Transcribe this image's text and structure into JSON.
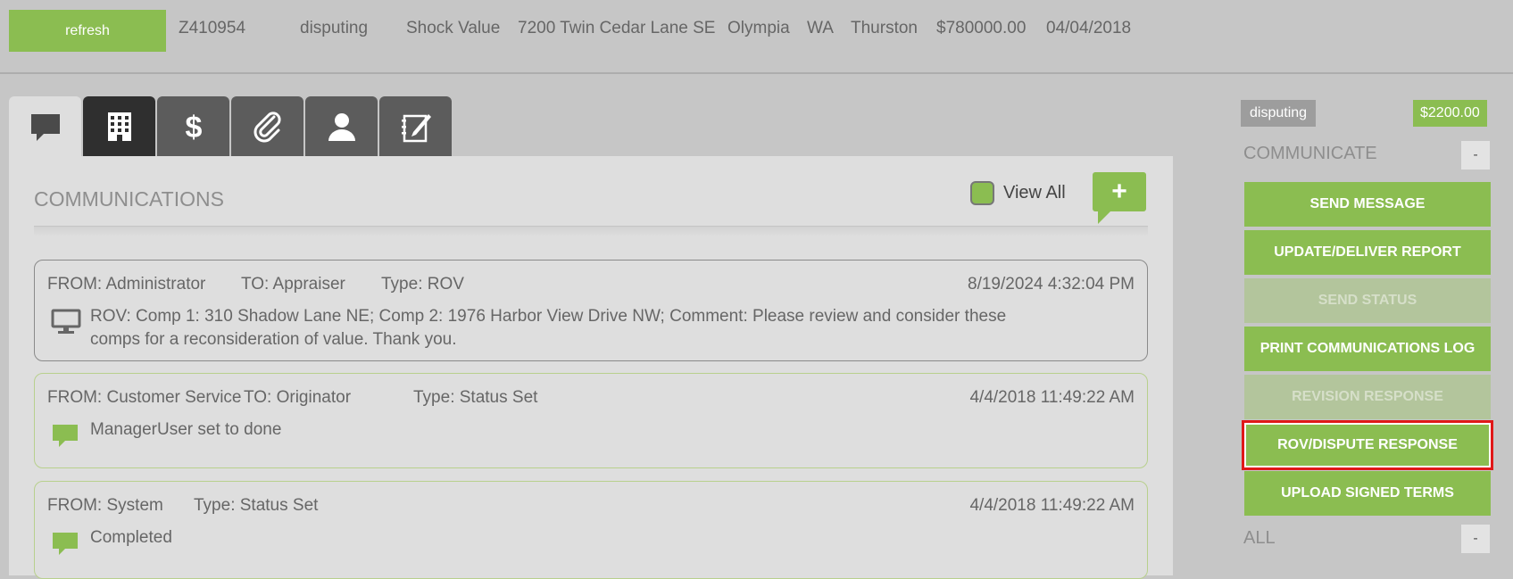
{
  "header": {
    "refresh_label": "refresh",
    "order_id": "Z410954",
    "status": "disputing",
    "borrower": "Shock Value",
    "address": "7200 Twin Cedar Lane SE",
    "city": "Olympia",
    "state": "WA",
    "county": "Thurston",
    "amount": "$780000.00",
    "date": "04/04/2018"
  },
  "tabs": [
    {
      "name": "communications-tab",
      "icon": "speech-bubble-icon"
    },
    {
      "name": "property-tab",
      "icon": "building-icon"
    },
    {
      "name": "fees-tab",
      "icon": "dollar-icon"
    },
    {
      "name": "attachments-tab",
      "icon": "paperclip-icon"
    },
    {
      "name": "contacts-tab",
      "icon": "person-icon"
    },
    {
      "name": "notes-tab",
      "icon": "notebook-pen-icon"
    }
  ],
  "communications": {
    "title": "COMMUNICATIONS",
    "view_all_label": "View All",
    "add_label": "+",
    "messages": [
      {
        "from": "FROM: Administrator",
        "to": "TO: Appraiser",
        "type": "Type: ROV",
        "date": "8/19/2024 4:32:04 PM",
        "body": "ROV: Comp 1: 310 Shadow Lane NE; Comp 2: 1976 Harbor View Drive NW; Comment: Please review and consider these comps for a reconsideration of value. Thank you.",
        "icon": "monitor-icon"
      },
      {
        "from": "FROM: Customer Service",
        "to": "TO: Originator",
        "type": "Type: Status Set",
        "date": "4/4/2018 11:49:22 AM",
        "body": "ManagerUser set to done",
        "icon": "speech-bubble-icon"
      },
      {
        "from": "FROM: System",
        "type": "Type: Status Set",
        "date": "4/4/2018 11:49:22 AM",
        "body": "Completed",
        "icon": "speech-bubble-icon"
      }
    ]
  },
  "sidebar": {
    "status_badge": "disputing",
    "fee_badge": "$2200.00",
    "communicate_label": "COMMUNICATE",
    "communicate_toggle": "-",
    "buttons": {
      "send_message": "SEND MESSAGE",
      "update_deliver": "UPDATE/DELIVER REPORT",
      "send_status": "SEND STATUS",
      "print_log": "PRINT COMMUNICATIONS LOG",
      "revision_response": "REVISION RESPONSE",
      "rov_response": "ROV/DISPUTE RESPONSE",
      "upload_terms": "UPLOAD SIGNED TERMS"
    },
    "all_label": "ALL",
    "all_toggle": "-"
  },
  "colors": {
    "accent_green": "#8bbd51",
    "highlight_red": "#e01818",
    "background": "#c6c6c6"
  }
}
